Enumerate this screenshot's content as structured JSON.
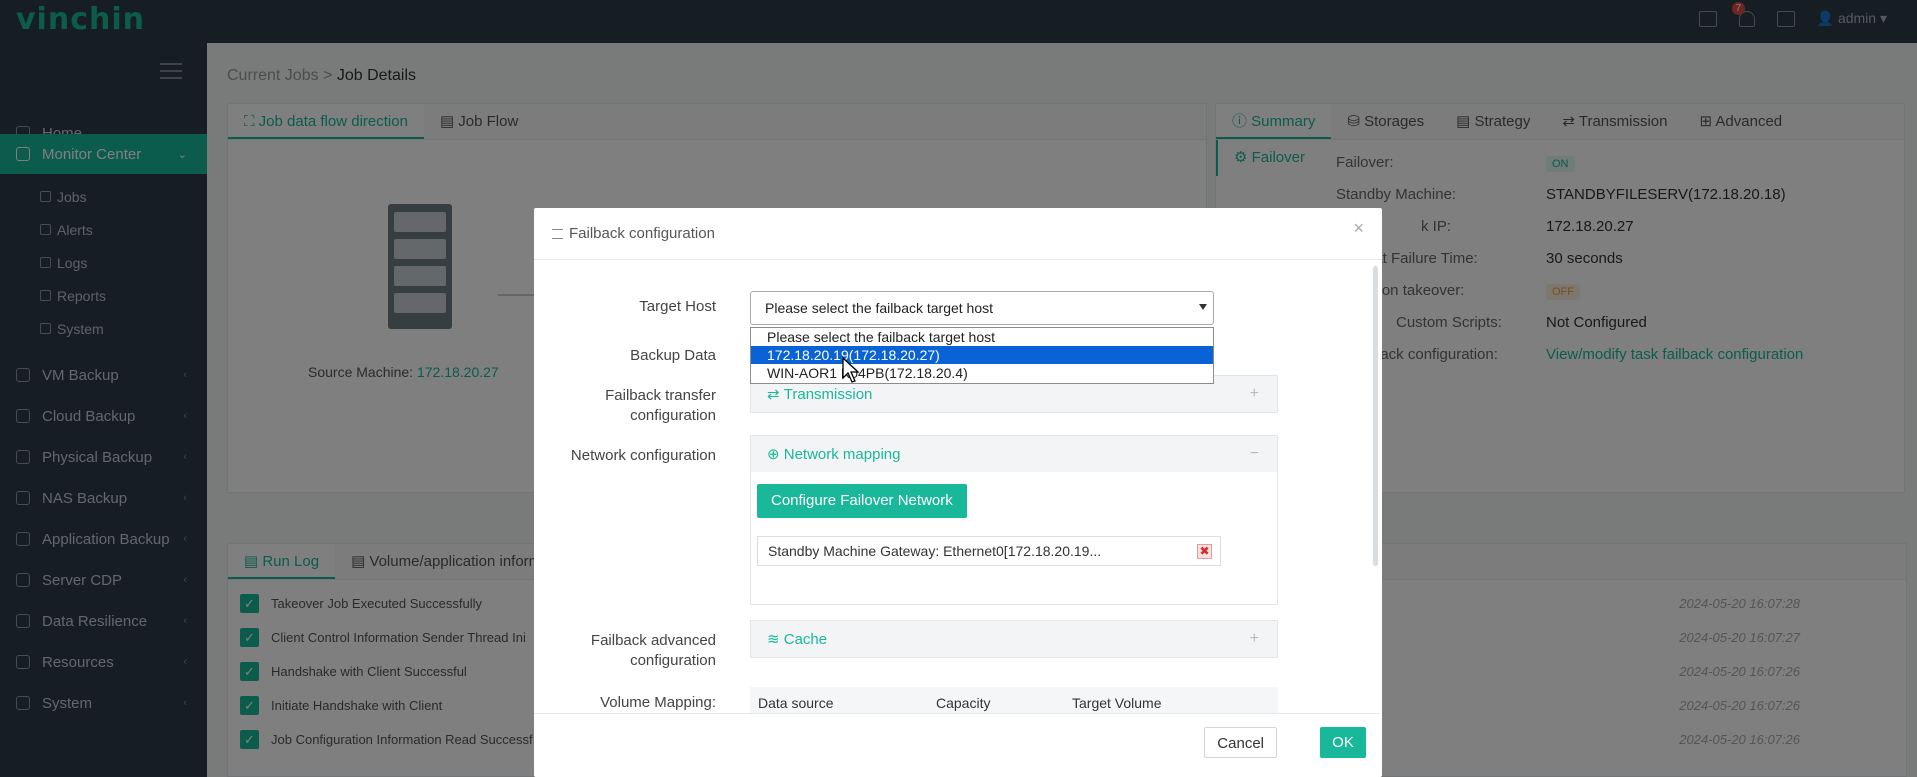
{
  "app": {
    "logo": "vinchin",
    "user": "admin",
    "notification_count": "7"
  },
  "sidebar": {
    "items": [
      {
        "label": "Home",
        "icon": "home-icon"
      },
      {
        "label": "Monitor Center",
        "icon": "monitor-icon",
        "active": true
      },
      {
        "label": "VM Backup",
        "icon": "vm-icon"
      },
      {
        "label": "Cloud Backup",
        "icon": "cloud-icon"
      },
      {
        "label": "Physical Backup",
        "icon": "physical-icon"
      },
      {
        "label": "NAS Backup",
        "icon": "nas-icon"
      },
      {
        "label": "Application Backup",
        "icon": "application-icon"
      },
      {
        "label": "Server CDP",
        "icon": "cdp-icon"
      },
      {
        "label": "Data Resilience",
        "icon": "resilience-icon"
      },
      {
        "label": "Resources",
        "icon": "resources-icon"
      },
      {
        "label": "System",
        "icon": "system-icon"
      }
    ],
    "subitems": [
      "Jobs",
      "Alerts",
      "Logs",
      "Reports",
      "System"
    ]
  },
  "breadcrumb": {
    "parent": "Current Jobs",
    "separator": ">",
    "current": "Job Details"
  },
  "flow_panel": {
    "tabs": [
      "Job data flow direction",
      "Job Flow"
    ],
    "source_label": "Source Machine:",
    "source_ip": "172.18.20.27"
  },
  "summary_panel": {
    "tabs": [
      "Summary",
      "Storages",
      "Strategy",
      "Transmission",
      "Advanced"
    ],
    "side_tab": "Failover",
    "rows": [
      {
        "label": "Failover:",
        "value": "ON"
      },
      {
        "label": "Standby Machine:",
        "value": "STANDBYFILESERV(172.18.20.18)"
      },
      {
        "label": "k IP:",
        "value": "172.18.20.27"
      },
      {
        "label": "eat Failure Time:",
        "value": "30 seconds"
      },
      {
        "label": "ation takeover:",
        "value": "OFF"
      },
      {
        "label": "Custom Scripts:",
        "value": "Not Configured"
      },
      {
        "label": "back configuration:",
        "value": "View/modify task failback configuration"
      }
    ]
  },
  "log_panel": {
    "tabs": [
      "Run Log",
      "Volume/application inform"
    ],
    "rows": [
      {
        "text": "Takeover Job Executed Successfully",
        "time": "2024-05-20 16:07:28"
      },
      {
        "text": "Client Control Information Sender Thread Ini",
        "time": "2024-05-20 16:07:27"
      },
      {
        "text": "Handshake with Client Successful",
        "time": "2024-05-20 16:07:26"
      },
      {
        "text": "Initiate Handshake with Client",
        "time": "2024-05-20 16:07:26"
      },
      {
        "text": "Job Configuration Information Read Successf",
        "time": "2024-05-20 16:07:26"
      }
    ]
  },
  "modal": {
    "title": "Failback configuration",
    "close": "×",
    "target_host_label": "Target Host",
    "target_host_value": "Please select the failback target host",
    "options": [
      "Please select the failback target host",
      "172.18.20.19(172.18.20.27)",
      "WIN-AOR1   K04PB(172.18.20.4)"
    ],
    "backup_data_label": "Backup Data",
    "transfer_label_1": "Failback transfer",
    "transfer_label_2": "configuration",
    "transmission": "Transmission",
    "network_label": "Network configuration",
    "network_mapping": "Network mapping",
    "configure_button": "Configure Failover Network",
    "gateway": "Standby Machine Gateway: Ethernet0[172.18.20.19...",
    "advanced_label_1": "Failback advanced",
    "advanced_label_2": "configuration",
    "cache": "Cache",
    "volume_label": "Volume Mapping:",
    "volume_columns": [
      "Data source",
      "Capacity",
      "Target Volume"
    ],
    "cancel": "Cancel",
    "ok": "OK"
  },
  "colors": {
    "accent": "#19b89a",
    "sidebar": "#2f3d47",
    "selected_option": "#0a63d6"
  }
}
